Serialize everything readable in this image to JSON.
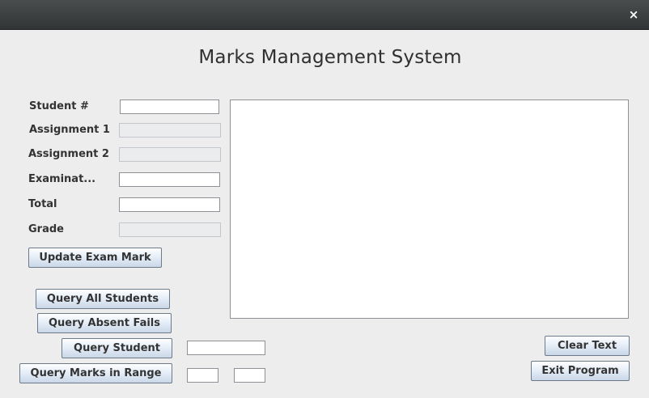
{
  "window": {
    "close_icon": "×",
    "heading": "Marks Management System"
  },
  "form": {
    "student_number_label": "Student #",
    "assignment1_label": "Assignment 1",
    "assignment2_label": "Assignment 2",
    "examination_label": "Examinat...",
    "total_label": "Total",
    "grade_label": "Grade",
    "student_number_value": "",
    "assignment1_value": "",
    "assignment2_value": "",
    "examination_value": "",
    "total_value": "",
    "grade_value": ""
  },
  "buttons": {
    "update_exam_mark": "Update Exam Mark",
    "query_all_students": "Query All Students",
    "query_absent_fails": "Query Absent Fails",
    "query_student": "Query Student",
    "query_marks_in_range": "Query Marks in Range",
    "clear_text": "Clear Text",
    "exit_program": "Exit Program"
  },
  "query": {
    "student_value": "",
    "range_min_value": "",
    "range_max_value": ""
  },
  "output": {
    "text": ""
  },
  "icons": {
    "close": "close-icon"
  }
}
